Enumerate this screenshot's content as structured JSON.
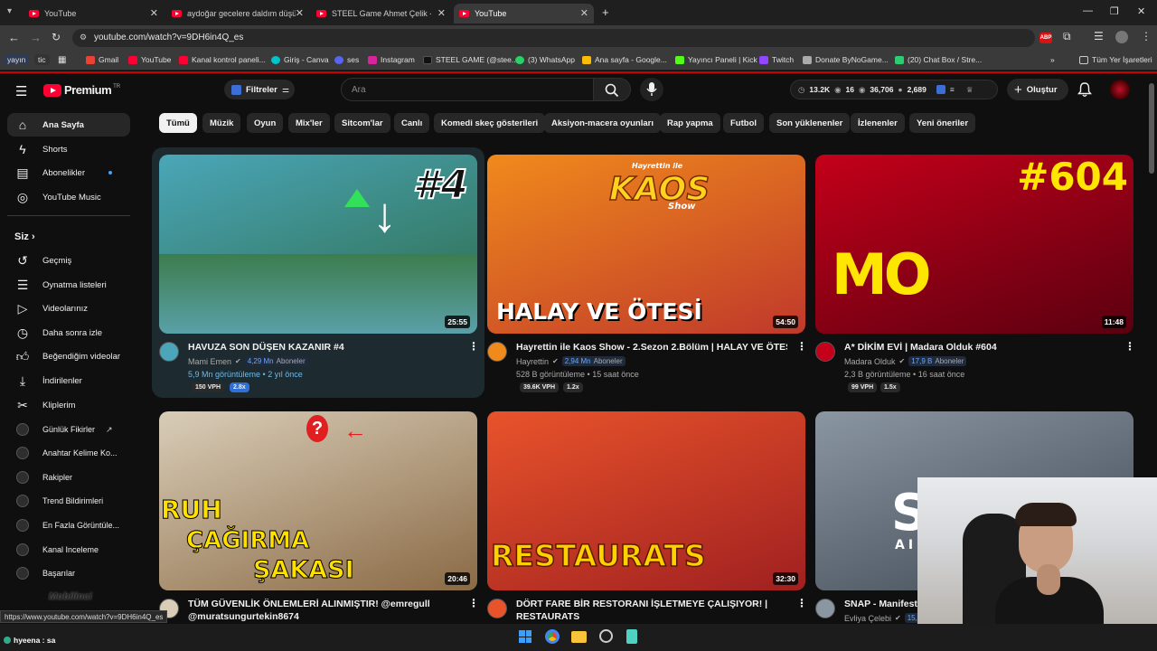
{
  "browser": {
    "tabs": [
      {
        "title": "YouTube"
      },
      {
        "title": "aydoğar gecelere daldım düşün"
      },
      {
        "title": "STEEL Game Ahmet Çelik - You"
      },
      {
        "title": "YouTube"
      }
    ],
    "url": "youtube.com/watch?v=9DH6in4Q_es",
    "status_url": "https://www.youtube.com/watch?v=9DH6in4Q_es",
    "bookmarks": [
      {
        "label": "yayın"
      },
      {
        "label": "tic"
      },
      {
        "label": "Gmail"
      },
      {
        "label": "YouTube"
      },
      {
        "label": "Kanal kontrol paneli..."
      },
      {
        "label": "Giriş - Canva"
      },
      {
        "label": "ses"
      },
      {
        "label": "Instagram"
      },
      {
        "label": "STEEL GAME (@stee..."
      },
      {
        "label": "(3) WhatsApp"
      },
      {
        "label": "Ana sayfa - Google..."
      },
      {
        "label": "Yayıncı Paneli | Kick"
      },
      {
        "label": "Twitch"
      },
      {
        "label": "Donate ByNoGame..."
      },
      {
        "label": "(20) Chat Box / Stre..."
      },
      {
        "label": "Tüm Yer İşaretleri"
      }
    ]
  },
  "header": {
    "logo": "Premium",
    "logo_sup": "TR",
    "filter_label": "Filtreler",
    "search_placeholder": "Ara",
    "stats": [
      "13.2K",
      "16",
      "36,706",
      "2,689"
    ],
    "create_label": "Oluştur"
  },
  "chips": [
    "Tümü",
    "Müzik",
    "Oyun",
    "Mix'ler",
    "Sitcom'lar",
    "Canlı",
    "Komedi skeç gösterileri",
    "Aksiyon-macera oyunları",
    "Rap yapma",
    "Futbol",
    "Son yüklenenler",
    "İzlenenler",
    "Yeni öneriler"
  ],
  "sidebar": {
    "main": [
      {
        "label": "Ana Sayfa",
        "icon": "home-icon"
      },
      {
        "label": "Shorts",
        "icon": "shorts-icon"
      },
      {
        "label": "Abonelikler",
        "icon": "subscriptions-icon"
      },
      {
        "label": "YouTube Music",
        "icon": "music-icon"
      }
    ],
    "you_heading": "Siz",
    "you": [
      {
        "label": "Geçmiş",
        "icon": "history-icon"
      },
      {
        "label": "Oynatma listeleri",
        "icon": "playlist-icon"
      },
      {
        "label": "Videolarınız",
        "icon": "video-icon"
      },
      {
        "label": "Daha sonra izle",
        "icon": "clock-icon"
      },
      {
        "label": "Beğendiğim videolar",
        "icon": "like-icon"
      },
      {
        "label": "İndirilenler",
        "icon": "download-icon"
      },
      {
        "label": "Kliplerim",
        "icon": "scissors-icon"
      }
    ],
    "extensions": [
      {
        "label": "Günlük Fikirler"
      },
      {
        "label": "Anahtar Kelime Ko..."
      },
      {
        "label": "Rakipler"
      },
      {
        "label": "Trend Bildirimleri"
      },
      {
        "label": "En Fazla Görüntüle..."
      },
      {
        "label": "Kanal Inceleme"
      },
      {
        "label": "Başarılar"
      }
    ]
  },
  "videos": [
    {
      "title": "HAVUZA SON DÜŞEN KAZANIR #4",
      "channel": "Mami Emen",
      "subs": "4,29 Mn",
      "subs_label": "Aboneler",
      "meta": "5,9 Mn görüntüleme • 2 yıl önce",
      "vph": "150 VPH",
      "ratio": "2.8x",
      "duration": "25:55",
      "overlay": "#4",
      "colors": [
        "#4aa6b8",
        "#2e6b4a"
      ]
    },
    {
      "title": "Hayrettin ile Kaos Show - 2.Sezon 2.Bölüm | HALAY VE ÖTESİ",
      "channel": "Hayrettin",
      "subs": "2,94 Mn",
      "subs_label": "Aboneler",
      "meta": "528 B görüntüleme • 15 saat önce",
      "vph": "39.6K VPH",
      "ratio": "1.2x",
      "duration": "54:50",
      "overlay": "HALAY VE ÖTESİ",
      "overlay2": "KAOS",
      "overlay3": "Hayrettin ile",
      "overlay4": "Show",
      "colors": [
        "#f08a1c",
        "#c0392b"
      ]
    },
    {
      "title": "A* DİKİM EVİ | Madara Olduk #604",
      "channel": "Madara Olduk",
      "subs": "17,9 B",
      "subs_label": "Aboneler",
      "meta": "2,3 B görüntüleme • 16 saat önce",
      "vph": "99 VPH",
      "ratio": "1.5x",
      "duration": "11:48",
      "overlay": "#604",
      "overlay2": "MO",
      "colors": [
        "#c4001a",
        "#5a0010"
      ]
    },
    {
      "title": "TÜM GÜVENLİK ÖNLEMLERİ ALINMIŞTIR! @emregull",
      "title2": "@muratsungurtekin8674",
      "duration": "20:46",
      "overlay": "RUH",
      "overlay2": "ÇAĞIRMA",
      "overlay3": "ŞAKASI",
      "colors": [
        "#d9cdb8",
        "#8a6a45"
      ]
    },
    {
      "title": "DÖRT FARE BİR RESTORANI İŞLETMEYE ÇALIŞIYOR! |",
      "title2": "RESTAURATS",
      "duration": "32:30",
      "overlay": "RESTAURATS",
      "colors": [
        "#e8532b",
        "#a02020"
      ]
    },
    {
      "title": "SNAP - Manifest",
      "channel": "Evliya Çelebi",
      "subs": "15,9 B",
      "overlay": "SI",
      "overlay2": "AI",
      "colors": [
        "#8b96a3",
        "#3f4852"
      ]
    }
  ],
  "bottom": {
    "chat": "hyeena : sa",
    "watermark": "Mobilinci"
  }
}
